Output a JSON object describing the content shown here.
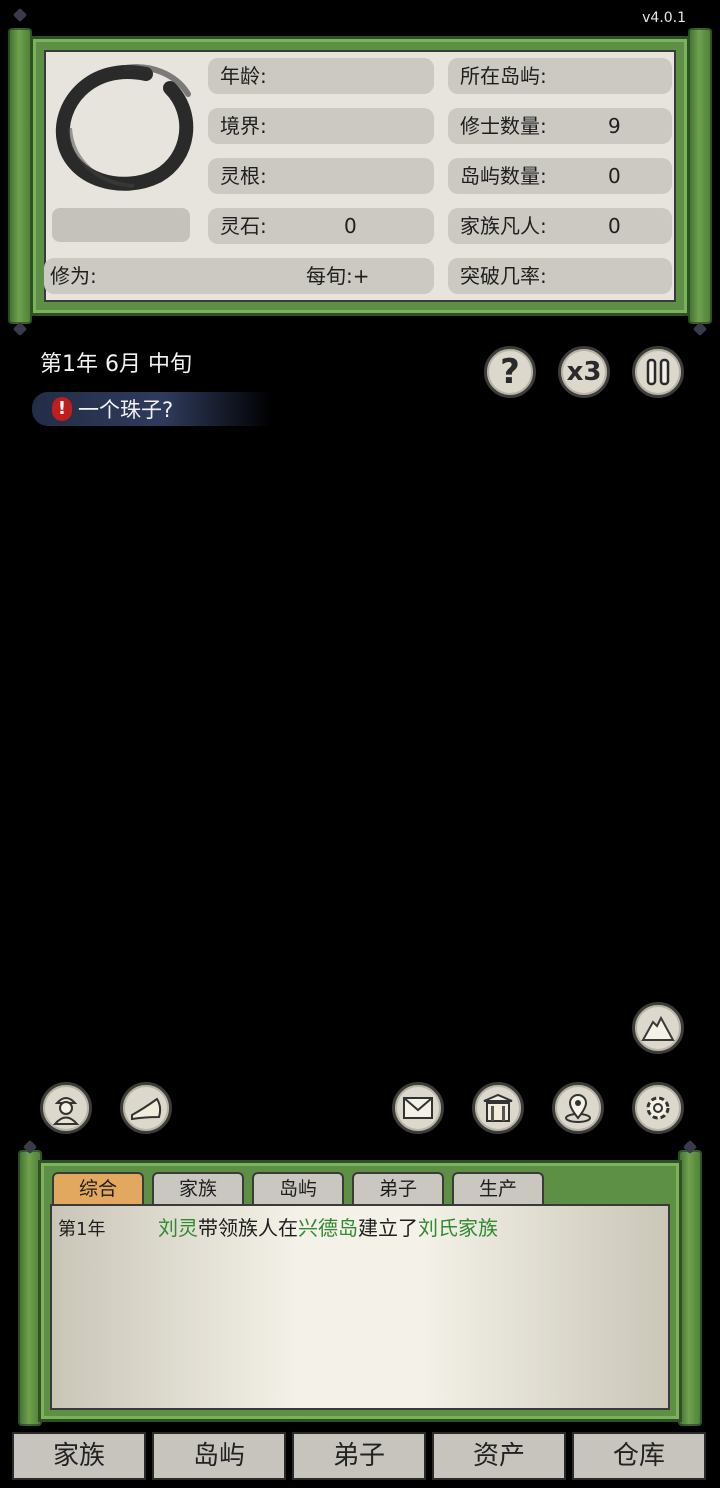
{
  "version": "v4.0.1",
  "stats": {
    "age_label": "年龄:",
    "age_value": "",
    "realm_label": "境界:",
    "realm_value": "",
    "root_label": "灵根:",
    "root_value": "",
    "stone_label": "灵石:",
    "stone_value": "0",
    "island_label": "所在岛屿:",
    "island_value": "",
    "cultivators_label": "修士数量:",
    "cultivators_value": "9",
    "islands_count_label": "岛屿数量:",
    "islands_count_value": "0",
    "mortals_label": "家族凡人:",
    "mortals_value": "0",
    "cultivation_label": "修为:",
    "per_period_label": "每旬:+",
    "breakthrough_label": "突破几率:",
    "breakthrough_value": ""
  },
  "date": "第1年 6月 中旬",
  "event": {
    "alert": "!",
    "text": "一个珠子?"
  },
  "controls": {
    "help": "?",
    "speed": "x3",
    "pause": "pause"
  },
  "icons": [
    "mountain-icon",
    "merchant-icon",
    "horn-icon",
    "mail-icon",
    "shrine-icon",
    "map-pin-icon",
    "settings-gear-icon"
  ],
  "tabs": [
    {
      "label": "综合",
      "active": true
    },
    {
      "label": "家族",
      "active": false
    },
    {
      "label": "岛屿",
      "active": false
    },
    {
      "label": "弟子",
      "active": false
    },
    {
      "label": "生产",
      "active": false
    }
  ],
  "log": {
    "year": "第1年",
    "p1": "刘灵",
    "p2": "带领族人在",
    "p3": "兴德岛",
    "p4": "建立了",
    "p5": "刘氏家族"
  },
  "colors": {
    "highlight": "#2e8b2e",
    "active_tab": "#e2a85f",
    "scroll_green": "#5d8f45"
  },
  "nav": [
    "家族",
    "岛屿",
    "弟子",
    "资产",
    "仓库"
  ]
}
